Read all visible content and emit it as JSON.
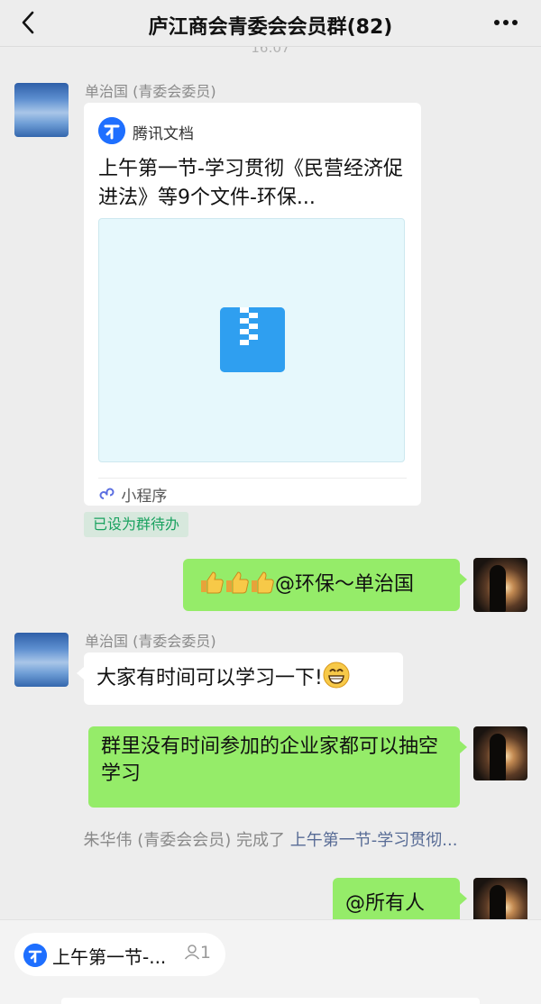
{
  "header": {
    "title": "庐江商会青委会会员群(82)"
  },
  "timestamp": "16:07",
  "messages": {
    "m1": {
      "sender": "单治国 (青委会委员)",
      "card": {
        "app_name": "腾讯文档",
        "title": "上午第一节-学习贯彻《民营经济促进法》等9个文件-环保...",
        "footer": "小程序"
      },
      "tag": "已设为群待办"
    },
    "m2": {
      "text": "@环保～单治国",
      "emoji": "thumbs-up x3"
    },
    "m3": {
      "sender": "单治国 (青委会委员)",
      "text": "大家有时间可以学习一下!",
      "emoji": "grinning-face"
    },
    "m4": {
      "text": "群里没有时间参加的企业家都可以抽空学习"
    },
    "system": {
      "prefix": "朱华伟 (青委会会员) 完成了",
      "link": "上午第一节-学习贯彻..."
    },
    "m5": {
      "text": "@所有人"
    }
  },
  "pinned": {
    "text": "上午第一节-...",
    "count": "1"
  },
  "colors": {
    "self_bubble": "#95ec69",
    "other_bubble": "#ffffff",
    "background": "#ededed",
    "link": "#576b95"
  }
}
